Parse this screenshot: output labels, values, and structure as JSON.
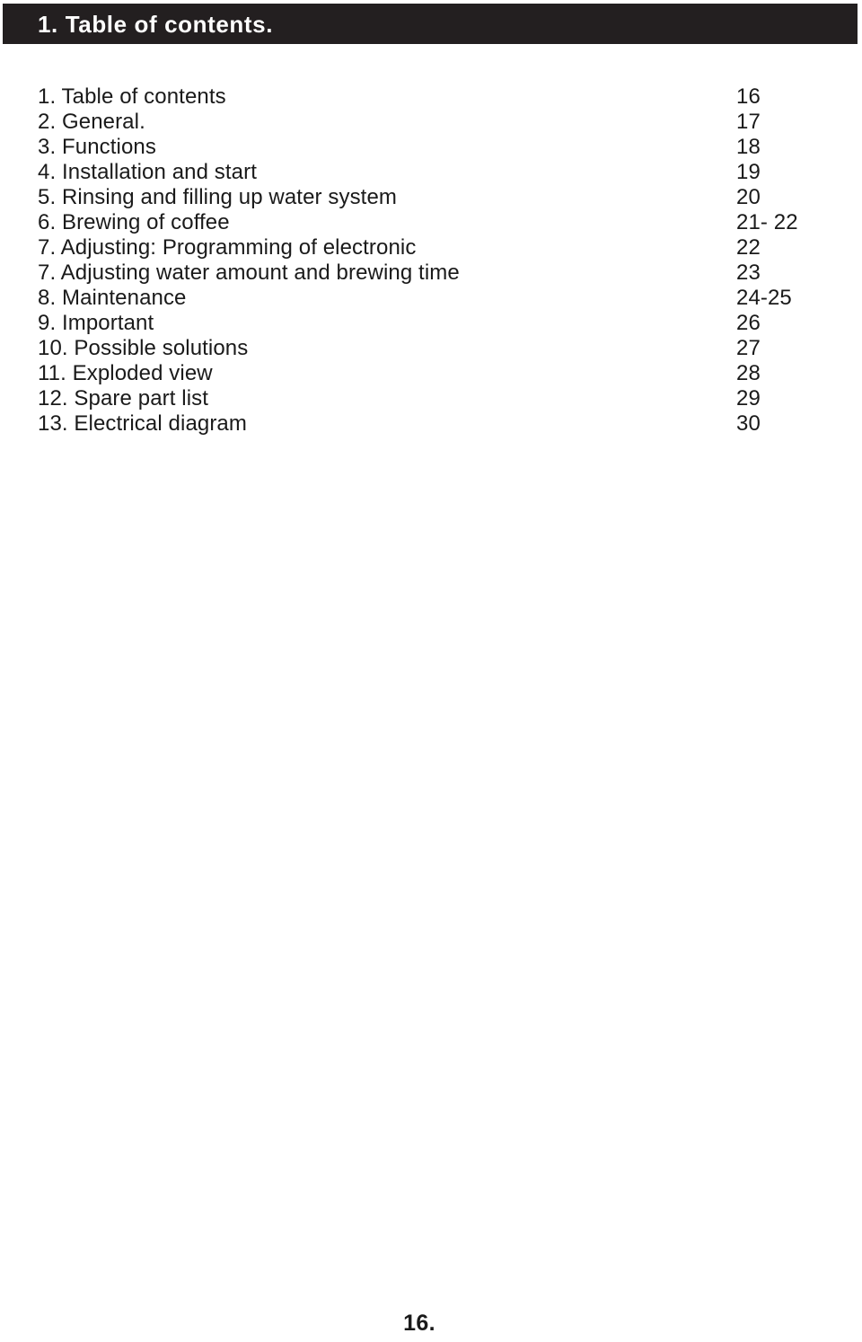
{
  "document": {
    "chapter_heading": "1. Table of contents.",
    "header_bar_color": "#231f20",
    "text_color": "#1a1a1a",
    "page_background": "#ffffff"
  },
  "toc": {
    "entries": [
      {
        "label": "1. Table of contents",
        "page": "16"
      },
      {
        "label": "2. General.",
        "page": "17"
      },
      {
        "label": "3. Functions",
        "page": "18"
      },
      {
        "label": "4. Installation and start",
        "page": "19"
      },
      {
        "label": "5. Rinsing and filling up water system",
        "page": "20"
      },
      {
        "label": "6. Brewing of coffee",
        "page": "21- 22"
      },
      {
        "label": "7. Adjusting: Programming of electronic",
        "page": "22"
      },
      {
        "label": "7. Adjusting water amount and brewing time",
        "page": "23"
      },
      {
        "label": "8. Maintenance",
        "page": "24-25"
      },
      {
        "label": "9. Important",
        "page": "26"
      },
      {
        "label": "10. Possible solutions",
        "page": "27"
      },
      {
        "label": "11. Exploded view",
        "page": "28"
      },
      {
        "label": "12. Spare part list",
        "page": "29"
      },
      {
        "label": "13. Electrical diagram",
        "page": "30"
      }
    ]
  },
  "footer": {
    "page_number": "16."
  }
}
